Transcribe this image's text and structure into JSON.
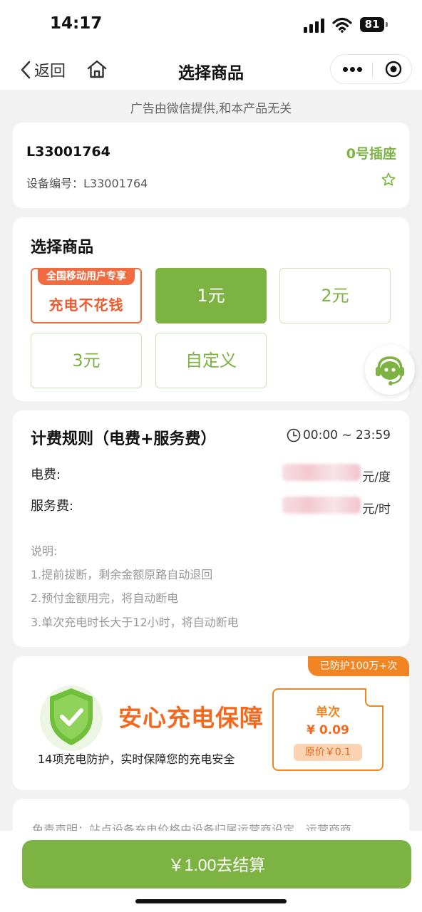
{
  "status_bar": {
    "time": "14:17",
    "battery": "81"
  },
  "nav": {
    "back_label": "返回",
    "title": "选择商品"
  },
  "ad_note": "广告由微信提供,和本产品无关",
  "device": {
    "id": "L33001764",
    "socket": "0号插座",
    "number_label": "设备编号：L33001764"
  },
  "goods": {
    "title": "选择商品",
    "promo": {
      "tag": "全国移动用户专享",
      "main": "充电不花钱"
    },
    "options": [
      "1元",
      "2元",
      "3元",
      "自定义"
    ],
    "selected": "1元"
  },
  "fees": {
    "title": "计费规则（电费+服务费）",
    "time_range": "00:00 ~ 23:59",
    "electric_label": "电费:",
    "electric_unit": "元/度",
    "service_label": "服务费:",
    "service_unit": "元/时",
    "notes": [
      "说明:",
      "1.提前拔断，剩余金额原路自动退回",
      "2.预付金额用完，将自动断电",
      "3.单次充电时长大于12小时，将自动断电"
    ]
  },
  "guarantee": {
    "tag": "已防护100万+次",
    "title": "安心充电保障",
    "desc": "14项充电防护，实时保障您的充电安全",
    "price_label": "单次",
    "price": "¥ 0.09",
    "original_price": "原价￥0.1"
  },
  "disclaimer": "免责声明：站点设备充电价格由设备归属运营商设定，运营商商",
  "checkout": {
    "label": "￥1.00去结算"
  },
  "colors": {
    "accent": "#7cb342",
    "orange": "#f28522",
    "promo_red": "#f26a3f"
  }
}
